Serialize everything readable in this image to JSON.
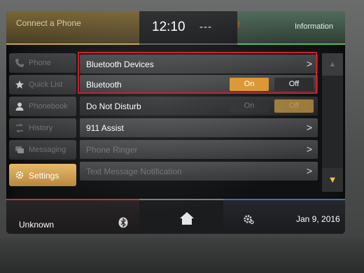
{
  "header": {
    "left_title": "Connect a Phone",
    "clock": "12:10",
    "temp_placeholder": "---",
    "alert": "!",
    "right_title": "Information"
  },
  "sidebar": {
    "items": [
      {
        "label": "Phone",
        "icon": "phone-icon",
        "active": false
      },
      {
        "label": "Quick List",
        "icon": "star-icon",
        "active": false
      },
      {
        "label": "Phonebook",
        "icon": "person-icon",
        "active": false
      },
      {
        "label": "History",
        "icon": "history-icon",
        "active": false
      },
      {
        "label": "Messaging",
        "icon": "messaging-icon",
        "active": false
      },
      {
        "label": "Settings",
        "icon": "gear-icon",
        "active": true
      }
    ]
  },
  "settings": {
    "rows": [
      {
        "label": "Bluetooth Devices",
        "type": "chevron",
        "enabled": true
      },
      {
        "label": "Bluetooth",
        "type": "toggle",
        "on_label": "On",
        "off_label": "Off",
        "selected": "On",
        "enabled": true
      },
      {
        "label": "Do Not Disturb",
        "type": "toggle",
        "on_label": "On",
        "off_label": "Off",
        "selected": "Off",
        "enabled": false
      },
      {
        "label": "911 Assist",
        "type": "chevron",
        "enabled": true
      },
      {
        "label": "Phone Ringer",
        "type": "chevron",
        "enabled": false
      },
      {
        "label": "Text Message Notification",
        "type": "chevron",
        "enabled": false
      }
    ],
    "chevron_glyph": ">"
  },
  "scrollbar": {
    "up_glyph": "▲",
    "down_glyph": "▼"
  },
  "footer": {
    "source": "Unknown",
    "date": "Jan 9, 2016"
  },
  "colors": {
    "active_tab": "#d9942f",
    "highlight_border": "#d01d2a",
    "phone_accent": "#c9a54a",
    "info_accent": "#59b564",
    "media_accent": "#b33a3e",
    "climate_accent": "#4b6db0"
  }
}
